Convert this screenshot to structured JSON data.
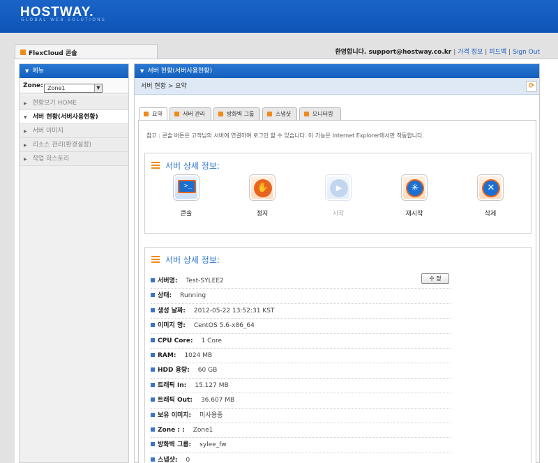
{
  "brand": {
    "logo": "HOSTWAY.",
    "tagline": "GLOBAL WEB SOLUTIONS"
  },
  "app_tab": {
    "label": "FlexCloud 콘솔"
  },
  "header_links": {
    "welcome": "환영합니다. support@hostway.co.kr",
    "pricing": "가격 정보",
    "feedback": "피드백",
    "signout": "Sign Out",
    "sep": "|"
  },
  "sidebar": {
    "title": "메뉴",
    "zone_label": "Zone:",
    "zone_value": "Zone1",
    "items": [
      {
        "label": "현황보기 HOME",
        "active": false
      },
      {
        "label": "서버 현황(서버사용현황)",
        "active": true
      },
      {
        "label": "서버 이미지",
        "active": false
      },
      {
        "label": "리소스 관리(환경설정)",
        "active": false
      },
      {
        "label": "작업 히스토리",
        "active": false
      }
    ]
  },
  "main": {
    "title": "서버 현황(서버사용현황)",
    "breadcrumb": "서버 현황 >  요약",
    "tabs": [
      "요약",
      "서버 관리",
      "방화벽 그룹",
      "스냅샷",
      "모니터링"
    ],
    "note": "참고 : 콘솔 버튼은 고객님의 서버에 연결하여 로그인 할 수 있습니다. 이 기능은 Internet Explorer에서만 작동합니다.",
    "actions_box_title": "서버 상세 정보:",
    "actions": [
      {
        "label": "콘솔",
        "icon": "console-icon",
        "color": "#1b6fd1"
      },
      {
        "label": "정지",
        "icon": "stop-hand-icon",
        "color": "#e8651f"
      },
      {
        "label": "시작",
        "icon": "play-icon",
        "color": "#b9d3ef",
        "disabled": true
      },
      {
        "label": "재시작",
        "icon": "restart-icon",
        "color": "#1b6fd1"
      },
      {
        "label": "삭제",
        "icon": "delete-icon",
        "color": "#1b6fd1"
      }
    ],
    "details_box_title": "서버 상세 정보:",
    "edit_button": "수 정",
    "details": [
      {
        "key": "서버명:",
        "value": "Test-SYLEE2"
      },
      {
        "key": "상태:",
        "value": "Running"
      },
      {
        "key": "생성 날짜:",
        "value": "2012-05-22 13:52:31 KST"
      },
      {
        "key": "이미지 명:",
        "value": "CentOS 5.6-x86_64"
      },
      {
        "key": "CPU Core:",
        "value": "1 Core"
      },
      {
        "key": "RAM:",
        "value": "1024 MB"
      },
      {
        "key": "HDD 용량:",
        "value": "60 GB"
      },
      {
        "key": "트래픽 In:",
        "value": "15.127 MB"
      },
      {
        "key": "트래픽 Out:",
        "value": "36.607 MB"
      },
      {
        "key": "보유 이미지:",
        "value": "미사용중"
      },
      {
        "key": "Zone : :",
        "value": "Zone1"
      },
      {
        "key": "방화벽 그룹:",
        "value": "sylee_fw"
      },
      {
        "key": "스냅샷:",
        "value": "0"
      }
    ]
  }
}
